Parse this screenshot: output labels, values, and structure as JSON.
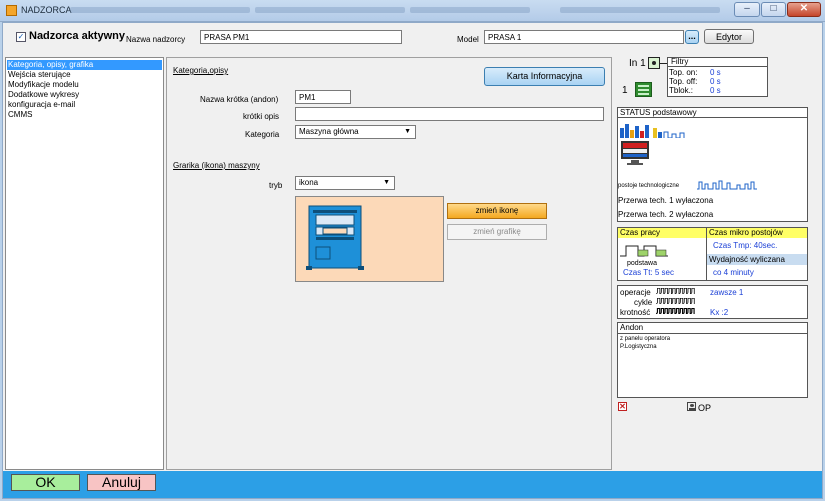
{
  "window": {
    "title": "NADZORCA",
    "controls": {
      "minimize": "–",
      "maximize": "□",
      "close": "✕"
    }
  },
  "toolbar": {
    "active_label": "Nadzorca aktywny",
    "active_checked": "✓",
    "name_label": "Nazwa nadzorcy",
    "name_value": "PRASA PM1",
    "model_label": "Model",
    "model_value": "PRASA 1",
    "browse_label": "...",
    "editor_label": "Edytor"
  },
  "nav": {
    "items": [
      {
        "label": "Kategoria, opisy, grafika"
      },
      {
        "label": "Wejścia sterujące"
      },
      {
        "label": "Modyfikacje modelu"
      },
      {
        "label": "Dodatkowe wykresy"
      },
      {
        "label": "konfiguracja e-mail"
      },
      {
        "label": "CMMS"
      }
    ]
  },
  "content": {
    "section1_title": "Kategoria,opisy",
    "info_button": "Karta Informacyjna",
    "short_name_label": "Nazwa krótka (andon)",
    "short_name_value": "PM1",
    "short_desc_label": "krótki opis",
    "short_desc_value": "",
    "category_label": "Kategoria",
    "category_value": "Maszyna główna",
    "section2_title": "Grarika (ikona) maszyny",
    "mode_label": "tryb",
    "mode_value": "ikona",
    "change_icon_button": "zmień ikonę",
    "change_graphic_button": "zmień grafikę"
  },
  "right": {
    "in_label": "In 1",
    "counter": "1",
    "filters_title": "Filtry",
    "top_on_label": "Top. on:",
    "top_on_value": "0 s",
    "top_off_label": "Top. off:",
    "top_off_value": "0 s",
    "tblok_label": "Tblok.:",
    "tblok_value": "0 s",
    "status_title": "STATUS podstawowy",
    "tech_stops_label": "postoje technologiczne",
    "break1": "Przerwa tech. 1 wyłaczona",
    "break2": "Przerwa tech. 2 wyłaczona",
    "work_time_title": "Czas pracy",
    "micro_stops_title": "Czas mikro postojów",
    "tmp_value": "Czas Tmp: 40sec.",
    "basic_label": "podstawa",
    "tt_value": "Czas Tt: 5 sec",
    "calc_eff_title": "Wydajność wyliczana",
    "calc_eff_value": "co 4 minuty",
    "operations_label": "operacje",
    "operations_value": "zawsze 1",
    "cycles_label": "cykle",
    "multiplicity_label": "krotność",
    "multiplicity_value": "Kx :2",
    "andon_title": "Andon",
    "andon_line1": "z panelu operatora",
    "andon_line2": "P.Logistyczna",
    "op_label": "OP"
  },
  "footer": {
    "ok_label": "OK",
    "cancel_label": "Anuluj"
  },
  "colors": {
    "accent_blue": "#2c9fe6",
    "nav_selected": "#3399ff",
    "ok_green": "#a8ee9c",
    "cancel_red": "#f8c4c4",
    "orange_button": "#f4a820",
    "icon_panel": "#fcd9b8"
  }
}
